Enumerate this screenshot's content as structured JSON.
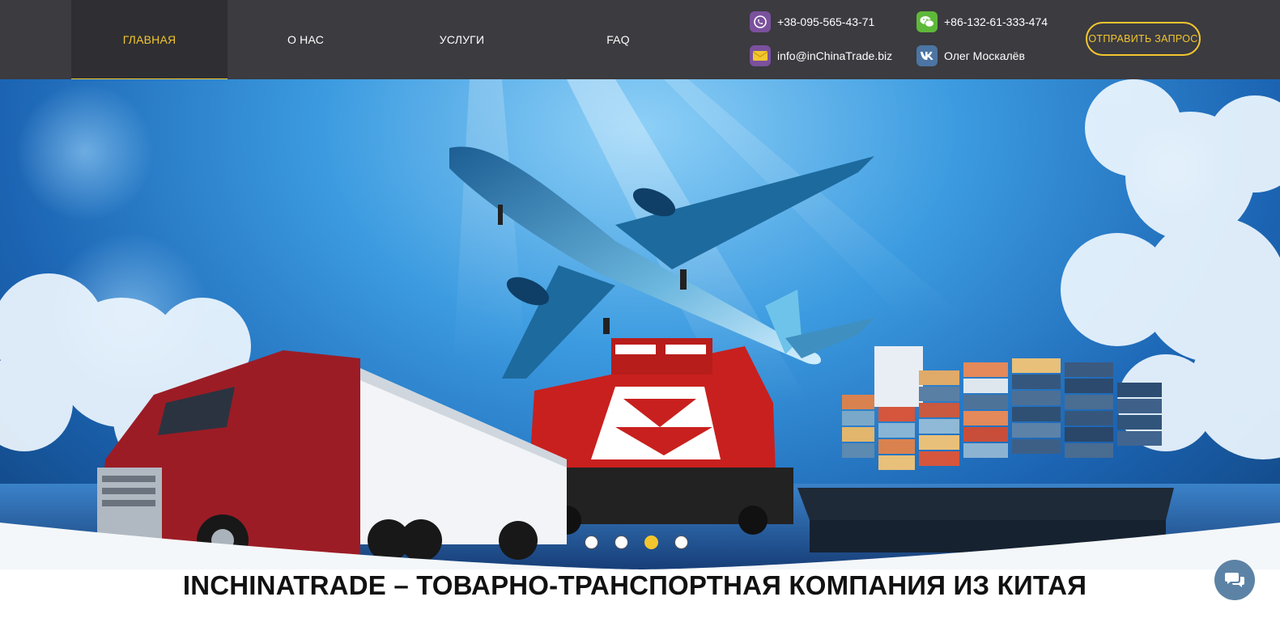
{
  "nav": {
    "items": [
      {
        "label": "ГЛАВНАЯ",
        "active": true
      },
      {
        "label": "О НАС",
        "active": false
      },
      {
        "label": "УСЛУГИ",
        "active": false
      },
      {
        "label": "FAQ",
        "active": false
      }
    ]
  },
  "contacts": {
    "viber": {
      "icon": "viber-icon",
      "text": "+38-095-565-43-71"
    },
    "wechat": {
      "icon": "wechat-icon",
      "text": "+86-132-61-333-474"
    },
    "email": {
      "icon": "mail-icon",
      "text": "info@inChinaTrade.biz"
    },
    "vk": {
      "icon": "vk-icon",
      "text": "Олег Москалёв"
    }
  },
  "cta": {
    "label": "ОТПРАВИТЬ  ЗАПРОС"
  },
  "slider": {
    "slide_count": 4,
    "active_index": 2
  },
  "hero": {
    "headline": "INCHINATRADE – ТОВАРНО-ТРАНСПОРТНАЯ КОМПАНИЯ ИЗ КИТАЯ"
  },
  "colors": {
    "header_bg": "#3b3b40",
    "accent": "#f3c62f",
    "chat": "#5c83a5"
  }
}
